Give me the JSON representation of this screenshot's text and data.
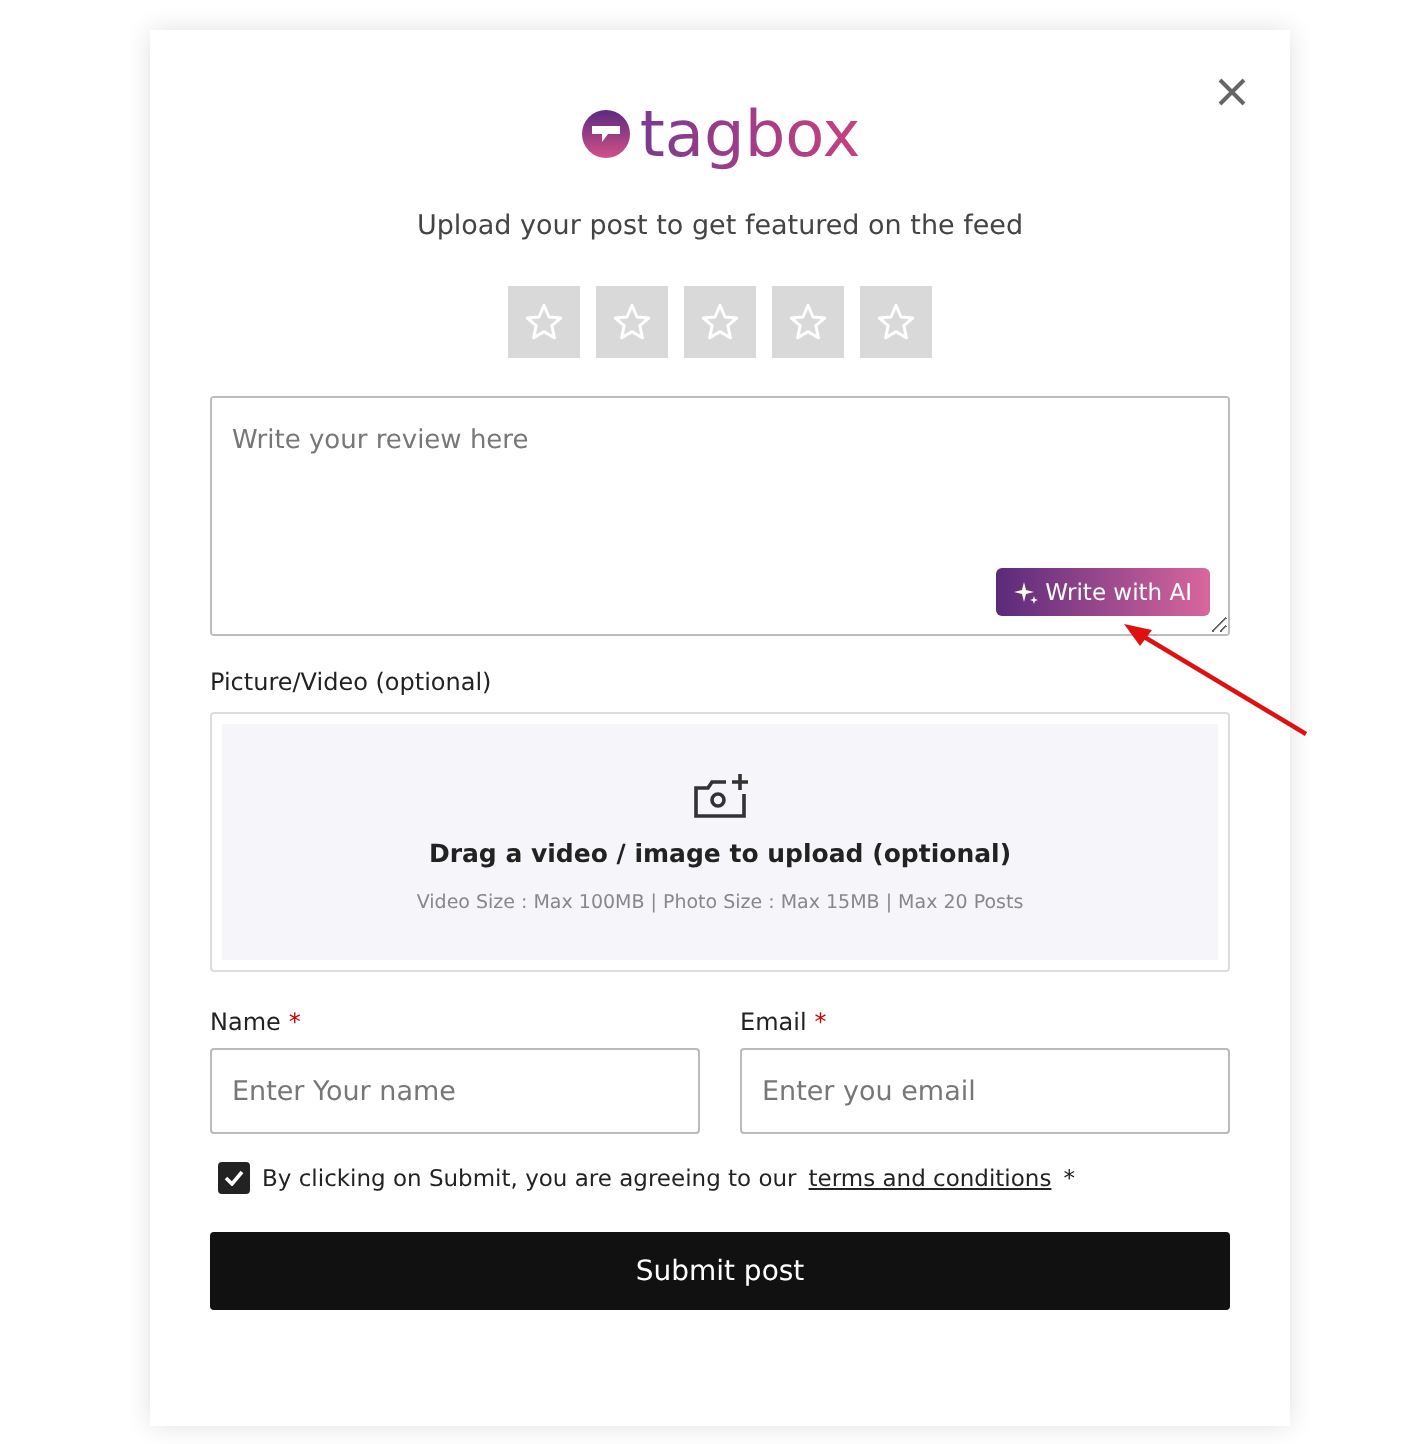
{
  "logo": {
    "text": "tagbox"
  },
  "subtitle": "Upload your post to get featured on the feed",
  "rating": {
    "stars": 0
  },
  "review": {
    "placeholder": "Write your review here",
    "ai_button": "Write with AI"
  },
  "media": {
    "label": "Picture/Video (optional)",
    "title": "Drag a video / image to upload (optional)",
    "limits": "Video Size : Max 100MB | Photo Size : Max 15MB | Max 20 Posts"
  },
  "fields": [
    {
      "label": "Name",
      "required": "*",
      "placeholder": "Enter Your name"
    },
    {
      "label": "Email",
      "required": "*",
      "placeholder": "Enter you email"
    }
  ],
  "consent": {
    "checked": true,
    "text": "By clicking on Submit, you are agreeing to our",
    "link": "terms and conditions",
    "required": "*"
  },
  "submit": "Submit post"
}
